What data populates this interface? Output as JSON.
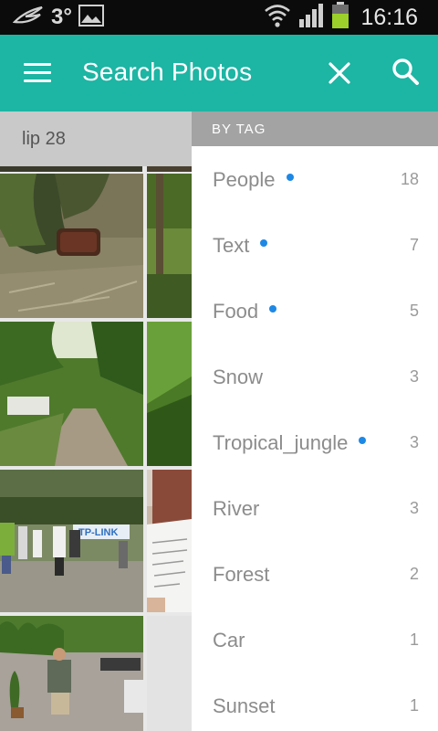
{
  "status_bar": {
    "temperature": "3°",
    "time": "16:16",
    "icons": [
      "weather-icon",
      "gallery-icon",
      "wifi-icon",
      "signal-icon",
      "battery-icon"
    ]
  },
  "app_bar": {
    "title": "Search Photos",
    "color": "#1db5a4",
    "icons": [
      "menu-icon",
      "close-icon",
      "search-icon"
    ]
  },
  "search": {
    "query": "lip 28"
  },
  "drawer": {
    "header": "BY TAG",
    "tags": [
      {
        "label": "People",
        "count": "18",
        "new": true
      },
      {
        "label": "Text",
        "count": "7",
        "new": true
      },
      {
        "label": "Food",
        "count": "5",
        "new": true
      },
      {
        "label": "Snow",
        "count": "3",
        "new": false
      },
      {
        "label": "Tropical_jungle",
        "count": "3",
        "new": true
      },
      {
        "label": "River",
        "count": "3",
        "new": false
      },
      {
        "label": "Forest",
        "count": "2",
        "new": false
      },
      {
        "label": "Car",
        "count": "1",
        "new": false
      },
      {
        "label": "Sunset",
        "count": "1",
        "new": false
      }
    ],
    "dot_color": "#1e88e5"
  },
  "photos": [
    {
      "name": "photo-tree-trunk-chest"
    },
    {
      "name": "photo-forest-edge"
    },
    {
      "name": "photo-dirt-road"
    },
    {
      "name": "photo-green-foliage"
    },
    {
      "name": "photo-group-tplink-banner"
    },
    {
      "name": "photo-person-reading-paper"
    },
    {
      "name": "photo-courtyard-man-walking"
    }
  ]
}
